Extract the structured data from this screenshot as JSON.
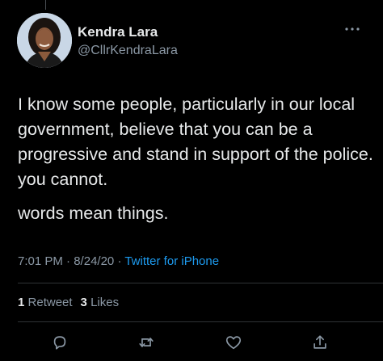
{
  "author": {
    "display_name": "Kendra Lara",
    "handle": "@CllrKendraLara",
    "avatar_icon": "profile-photo"
  },
  "tweet": {
    "paragraphs": [
      "I know some people, particularly in our local government, believe that you can be a progressive and stand in support of the police. you cannot.",
      "words mean things."
    ],
    "time": "7:01 PM",
    "date": "8/24/20",
    "separator": "·",
    "source": "Twitter for iPhone"
  },
  "stats": {
    "retweets_count": "1",
    "retweets_label": "Retweet",
    "likes_count": "3",
    "likes_label": "Likes"
  },
  "actions": [
    {
      "name": "reply",
      "icon": "speech-bubble-icon"
    },
    {
      "name": "retweet",
      "icon": "retweet-arrows-icon"
    },
    {
      "name": "like",
      "icon": "heart-icon"
    },
    {
      "name": "share",
      "icon": "share-upload-icon"
    }
  ],
  "colors": {
    "background": "#000000",
    "text_primary": "#e7e9ea",
    "text_secondary": "#8b98a5",
    "link": "#1d9bf0",
    "divider": "#2f3336"
  }
}
